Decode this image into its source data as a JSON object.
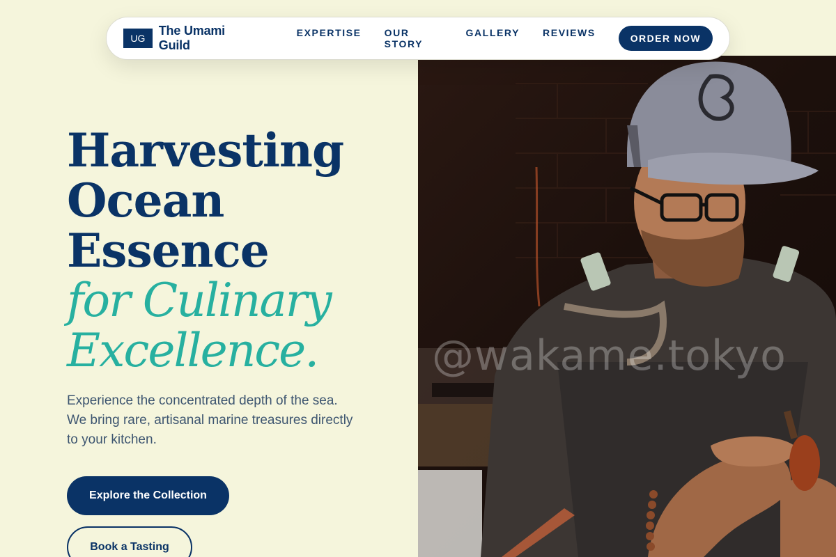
{
  "nav": {
    "logo_initials": "UG",
    "brand_name": "The Umami Guild",
    "items": [
      {
        "label": "EXPERTISE"
      },
      {
        "label": "OUR STORY"
      },
      {
        "label": "GALLERY"
      },
      {
        "label": "REVIEWS"
      }
    ],
    "cta_label": "ORDER NOW"
  },
  "hero": {
    "title_lines": [
      "Harvesting",
      "Ocean",
      "Essence"
    ],
    "title_accent_lines": [
      "for Culinary",
      "Excellence."
    ],
    "subtitle": "Experience the concentrated depth of the sea. We bring rare, artisanal marine treasures directly to your kitchen.",
    "primary_button": "Explore the Collection",
    "secondary_button": "Book a Tasting",
    "image_watermark": "@wakame.tokyo"
  },
  "colors": {
    "background": "#f5f5dc",
    "navy": "#0a3366",
    "teal_accent": "#27b0a0",
    "body_text": "#3d5570"
  }
}
